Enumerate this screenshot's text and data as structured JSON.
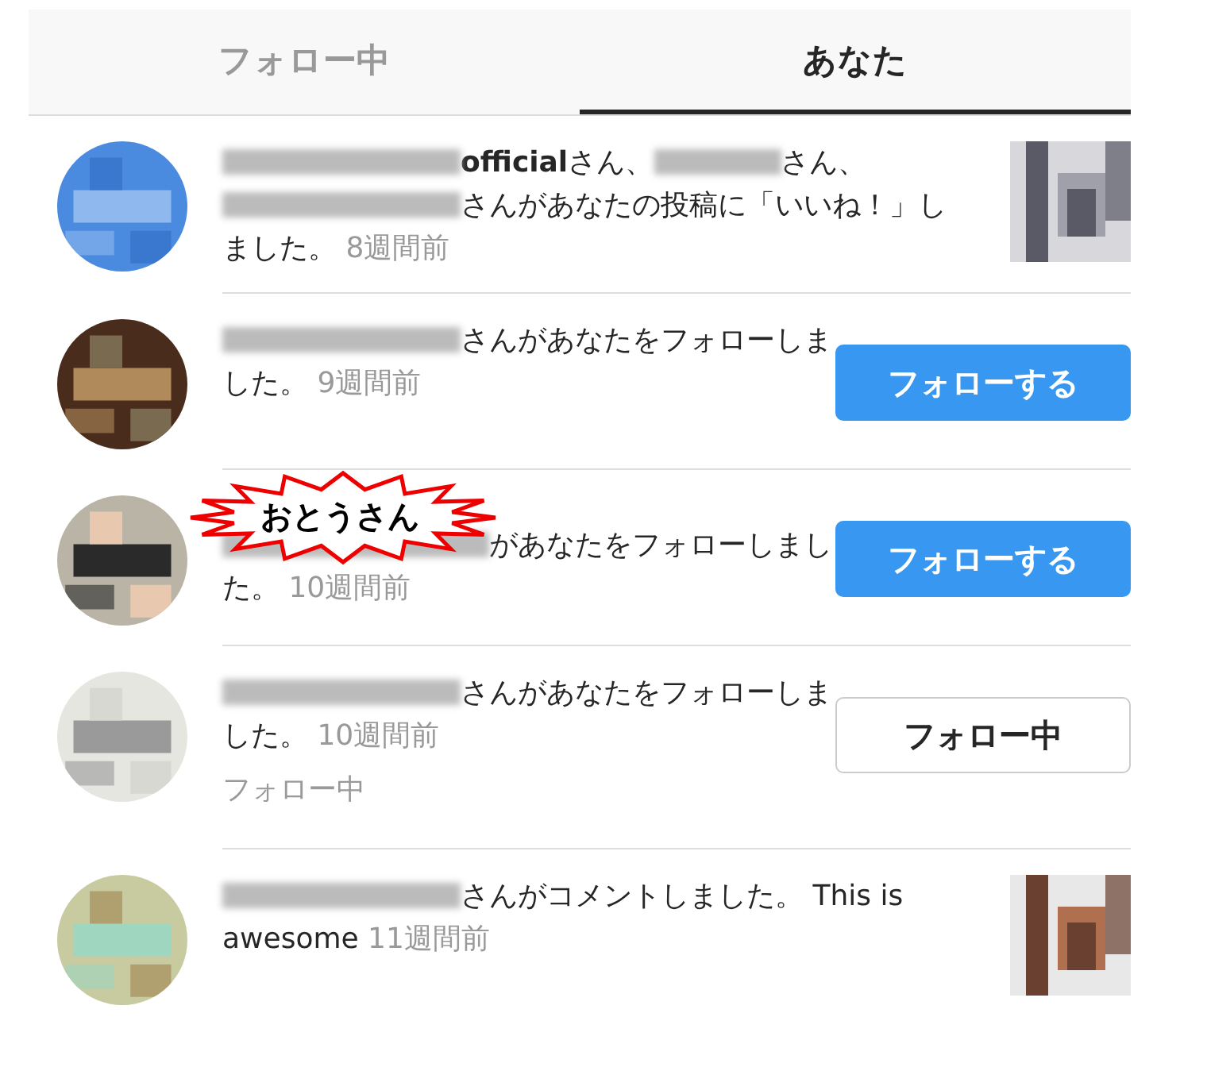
{
  "tabs": [
    {
      "label": "フォロー中",
      "selected": false
    },
    {
      "label": "あなた",
      "selected": true
    }
  ],
  "items": [
    {
      "message": [
        {
          "kind": "redacted"
        },
        {
          "kind": "name",
          "text": "official"
        },
        {
          "kind": "text",
          "text": "さん、"
        },
        {
          "kind": "redacted"
        },
        {
          "kind": "text",
          "text": "さん、"
        },
        {
          "kind": "redacted"
        },
        {
          "kind": "text",
          "text": "さんがあなたの投稿に「いいね！」しました。"
        }
      ],
      "time": "8週間前",
      "action": {
        "kind": "thumbnail"
      }
    },
    {
      "message": [
        {
          "kind": "redacted"
        },
        {
          "kind": "text",
          "text": "さんがあなたをフォローしました。"
        }
      ],
      "time": "9週間前",
      "action": {
        "kind": "follow",
        "label": "フォローする"
      }
    },
    {
      "message": [
        {
          "kind": "redacted"
        },
        {
          "kind": "text",
          "text": "があなたをフォローしました。"
        }
      ],
      "time": "10週間前",
      "callout": "おとうさん",
      "action": {
        "kind": "follow",
        "label": "フォローする"
      }
    },
    {
      "message": [
        {
          "kind": "redacted"
        },
        {
          "kind": "text",
          "text": "さんがあなたをフォローしました。"
        }
      ],
      "time": "10週間前",
      "status": "フォロー中",
      "action": {
        "kind": "following",
        "label": "フォロー中"
      }
    },
    {
      "message": [
        {
          "kind": "redacted"
        },
        {
          "kind": "text",
          "text": "さんがコメントしました。 This is awesome"
        }
      ],
      "time": "11週間前",
      "action": {
        "kind": "thumbnail"
      }
    }
  ]
}
